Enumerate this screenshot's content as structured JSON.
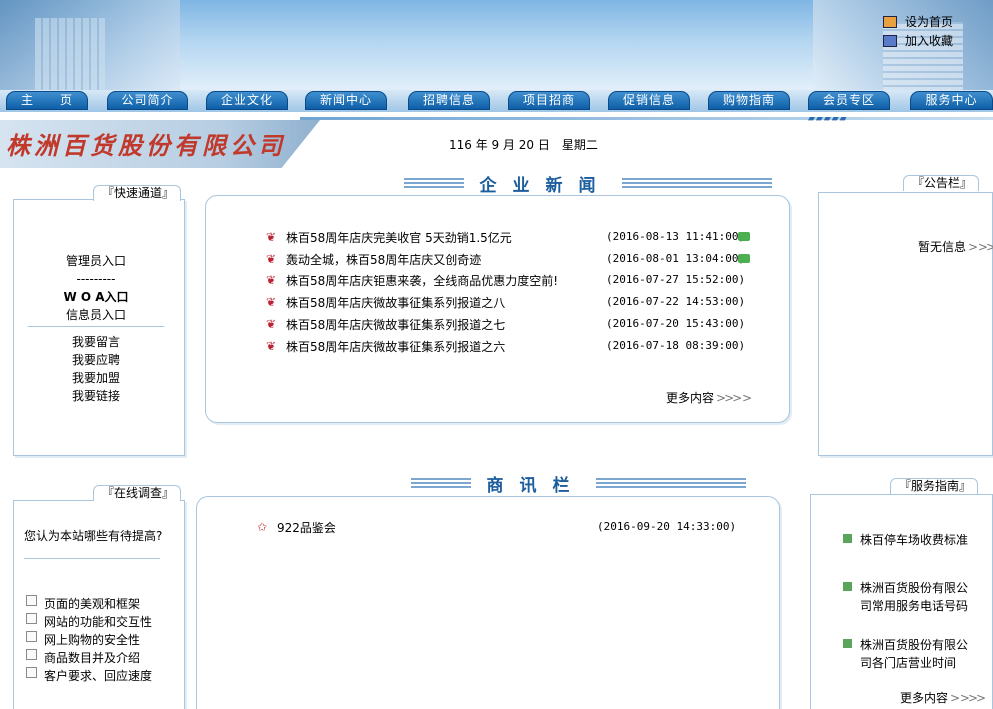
{
  "header": {
    "set_home": "设为首页",
    "add_favorite": "加入收藏"
  },
  "nav": {
    "items": [
      "主　　页",
      "公司简介",
      "企业文化",
      "新闻中心",
      "招聘信息",
      "项目招商",
      "促销信息",
      "购物指南",
      "会员专区",
      "服务中心"
    ]
  },
  "company": {
    "name": "株洲百货股份有限公司"
  },
  "date": {
    "text": "116 年 9 月 20 日　星期二"
  },
  "quick": {
    "tab": "『快速通道』",
    "admin": "管理员入口",
    "dashes": "---------",
    "woa": "W O A入口",
    "info": "信息员入口",
    "message": "我要留言",
    "apply": "我要应聘",
    "join": "我要加盟",
    "link": "我要链接"
  },
  "news": {
    "heading": "企业新闻",
    "items": [
      {
        "title": "株百58周年店庆完美收官 5天劲销1.5亿元",
        "time": "(2016-08-13 11:41:00)",
        "photo": true
      },
      {
        "title": "轰动全城，株百58周年店庆又创奇迹",
        "time": "(2016-08-01 13:04:00)",
        "photo": true
      },
      {
        "title": "株百58周年店庆钜惠来袭，全线商品优惠力度空前!",
        "time": "(2016-07-27 15:52:00)",
        "photo": false
      },
      {
        "title": "株百58周年店庆微故事征集系列报道之八",
        "time": "(2016-07-22 14:53:00)",
        "photo": false
      },
      {
        "title": "株百58周年店庆微故事征集系列报道之七",
        "time": "(2016-07-20 15:43:00)",
        "photo": false
      },
      {
        "title": "株百58周年店庆微故事征集系列报道之六",
        "time": "(2016-07-18 08:39:00)",
        "photo": false
      }
    ],
    "more": "更多内容"
  },
  "notice": {
    "tab": "『公告栏』",
    "empty": "暂无信息"
  },
  "survey": {
    "tab": "『在线调查』",
    "question": "您认为本站哪些有待提高?",
    "options": [
      "页面的美观和框架",
      "网站的功能和交互性",
      "网上购物的安全性",
      "商品数目并及介绍",
      "客户要求、回应速度"
    ]
  },
  "business": {
    "heading": "商讯栏",
    "items": [
      {
        "title": "922品鉴会",
        "time": "(2016-09-20 14:33:00)"
      }
    ]
  },
  "service": {
    "tab": "『服务指南』",
    "items": [
      "株百停车场收费标准",
      "株洲百货股份有限公司常用服务电话号码",
      "株洲百货股份有限公司各门店营业时间"
    ],
    "more": "更多内容"
  }
}
